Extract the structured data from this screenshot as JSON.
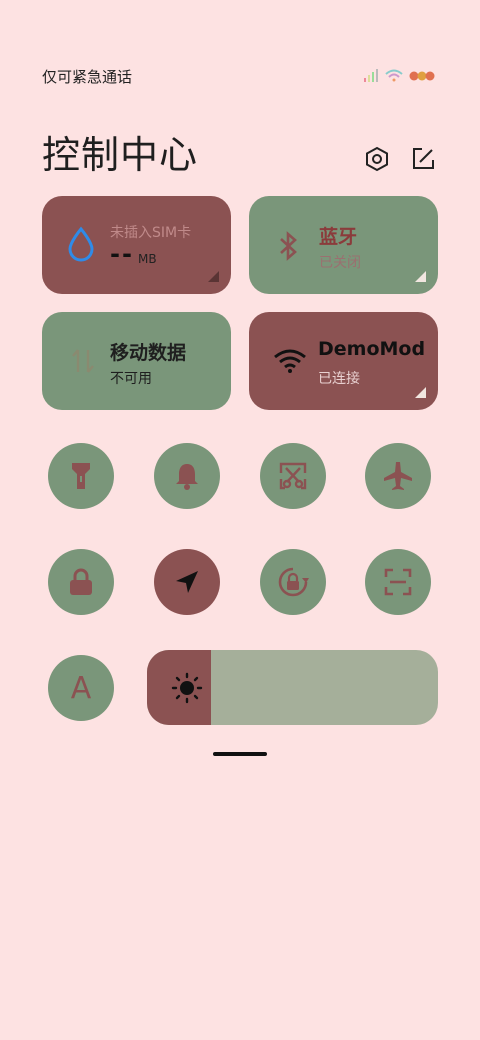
{
  "status_bar": {
    "carrier_text": "仅可紧急通话",
    "icons": [
      "signal-icon",
      "wifi-icon",
      "battery-icon"
    ]
  },
  "header": {
    "title": "控制中心",
    "icons": [
      "settings-icon",
      "edit-icon"
    ]
  },
  "big_tiles": {
    "data_usage": {
      "label": "未插入SIM卡",
      "value": "--",
      "unit": "MB",
      "icon": "water-drop-icon",
      "state": "inactive"
    },
    "bluetooth": {
      "title": "蓝牙",
      "status": "已关闭",
      "icon": "bluetooth-icon",
      "state": "off"
    },
    "mobile_data": {
      "title": "移动数据",
      "status": "不可用",
      "icon": "arrows-updown-icon",
      "state": "unavailable"
    },
    "wifi": {
      "title": "DemoMod",
      "status": "已连接",
      "icon": "wifi-icon",
      "state": "on"
    }
  },
  "toggles_row1": [
    {
      "name": "flashlight",
      "icon": "flashlight-icon",
      "on": false
    },
    {
      "name": "mute",
      "icon": "bell-icon",
      "on": false
    },
    {
      "name": "screenshot",
      "icon": "scissors-icon",
      "on": false
    },
    {
      "name": "airplane",
      "icon": "airplane-icon",
      "on": false
    }
  ],
  "toggles_row2": [
    {
      "name": "lock-screen",
      "icon": "lock-icon",
      "on": false
    },
    {
      "name": "location",
      "icon": "location-arrow-icon",
      "on": true
    },
    {
      "name": "rotation-lock",
      "icon": "rotation-lock-icon",
      "on": false
    },
    {
      "name": "scanner",
      "icon": "scan-icon",
      "on": false
    }
  ],
  "font_toggle": {
    "label": "A"
  },
  "brightness": {
    "level": 0.22,
    "icon": "sun-icon"
  },
  "colors": {
    "background": "#fde2e2",
    "active": "#8b5252",
    "inactive": "#7a967a",
    "slider_track": "#a5af9a"
  }
}
